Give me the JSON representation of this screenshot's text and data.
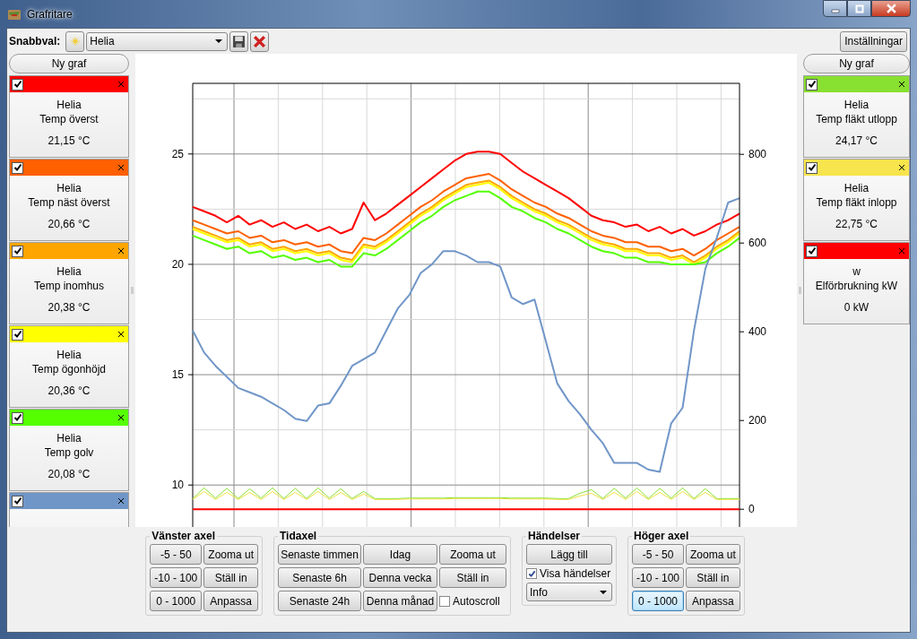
{
  "window": {
    "title": "Grafritare"
  },
  "toolbar": {
    "label": "Snabbval:",
    "preset": "Helia",
    "settings_button": "Inställningar"
  },
  "left_panel": {
    "new_button": "Ny graf",
    "series": [
      {
        "color": "#ff0000",
        "checked": true,
        "source": "Helia",
        "name": "Temp överst",
        "value": "21,15 °C"
      },
      {
        "color": "#ff6000",
        "checked": true,
        "source": "Helia",
        "name": "Temp näst överst",
        "value": "20,66 °C"
      },
      {
        "color": "#ffa500",
        "checked": true,
        "source": "Helia",
        "name": "Temp inomhus",
        "value": "20,38 °C"
      },
      {
        "color": "#ffff00",
        "checked": true,
        "source": "Helia",
        "name": "Temp ögonhöjd",
        "value": "20,36 °C"
      },
      {
        "color": "#55ff00",
        "checked": true,
        "source": "Helia",
        "name": "Temp golv",
        "value": "20,08 °C"
      },
      {
        "color": "#7096c8",
        "checked": true
      }
    ]
  },
  "right_panel": {
    "new_button": "Ny graf",
    "series": [
      {
        "color": "#88e030",
        "checked": true,
        "source": "Helia",
        "name": "Temp fläkt utlopp",
        "value": "24,17 °C"
      },
      {
        "color": "#f8e44c",
        "checked": true,
        "source": "Helia",
        "name": "Temp fläkt inlopp",
        "value": "22,75 °C"
      },
      {
        "color": "#ff0000",
        "checked": true,
        "source": "w",
        "name": "Elförbrukning kW",
        "value": "0 kW"
      }
    ]
  },
  "plot_left": {
    "chart_data": {
      "type": "line",
      "categories": [
        null,
        null,
        null,
        null,
        null,
        null,
        null,
        null,
        null,
        null,
        null,
        null,
        null,
        null,
        null,
        null,
        null,
        null,
        null,
        null,
        null,
        null,
        null,
        null,
        null,
        null,
        null,
        null,
        null,
        null,
        null,
        null,
        null,
        null,
        null,
        null,
        null,
        null,
        null,
        null,
        null,
        null,
        null,
        null,
        null,
        null,
        null,
        null,
        null
      ],
      "ylim": [
        8.1,
        28.2
      ],
      "yticks": [
        10,
        15,
        20,
        25
      ],
      "grid": true,
      "series": [
        {
          "color": "#ff0000",
          "values": [
            22.6,
            22.4,
            22.2,
            21.9,
            22.2,
            21.8,
            22.0,
            21.7,
            21.9,
            21.6,
            21.8,
            21.5,
            21.7,
            21.4,
            21.6,
            22.8,
            22.0,
            22.3,
            22.7,
            23.1,
            23.5,
            23.9,
            24.3,
            24.7,
            25.0,
            25.1,
            25.1,
            25.0,
            24.6,
            24.2,
            23.9,
            23.6,
            23.3,
            23.0,
            22.6,
            22.2,
            22.0,
            21.9,
            21.7,
            21.8,
            21.5,
            21.7,
            21.4,
            21.6,
            21.3,
            21.5,
            21.8,
            22.0,
            22.3
          ]
        },
        {
          "color": "#ff6000",
          "values": [
            22.0,
            21.8,
            21.6,
            21.4,
            21.5,
            21.2,
            21.3,
            21.0,
            21.1,
            20.9,
            21.0,
            20.8,
            20.9,
            20.6,
            20.5,
            21.2,
            21.1,
            21.4,
            21.8,
            22.2,
            22.6,
            22.9,
            23.3,
            23.6,
            23.9,
            24.0,
            24.1,
            23.8,
            23.4,
            23.1,
            22.8,
            22.6,
            22.3,
            22.1,
            21.8,
            21.5,
            21.3,
            21.2,
            21.0,
            21.0,
            20.8,
            20.8,
            20.6,
            20.7,
            20.4,
            20.7,
            21.1,
            21.4,
            21.7
          ]
        },
        {
          "color": "#ffa500",
          "values": [
            21.7,
            21.5,
            21.3,
            21.1,
            21.2,
            20.9,
            21.0,
            20.7,
            20.8,
            20.6,
            20.7,
            20.5,
            20.6,
            20.3,
            20.2,
            20.9,
            20.8,
            21.1,
            21.5,
            21.9,
            22.3,
            22.6,
            23.0,
            23.3,
            23.6,
            23.7,
            23.8,
            23.5,
            23.1,
            22.8,
            22.5,
            22.3,
            22.0,
            21.8,
            21.5,
            21.2,
            21.0,
            20.9,
            20.7,
            20.7,
            20.5,
            20.5,
            20.3,
            20.4,
            20.1,
            20.4,
            20.8,
            21.1,
            21.5
          ]
        },
        {
          "color": "#ffff00",
          "values": [
            21.6,
            21.4,
            21.2,
            21.0,
            21.1,
            20.8,
            20.9,
            20.6,
            20.7,
            20.5,
            20.6,
            20.4,
            20.5,
            20.2,
            20.1,
            20.8,
            20.7,
            21.0,
            21.4,
            21.8,
            22.2,
            22.5,
            22.9,
            23.2,
            23.5,
            23.6,
            23.7,
            23.4,
            23.0,
            22.7,
            22.4,
            22.2,
            21.9,
            21.7,
            21.4,
            21.1,
            20.9,
            20.8,
            20.6,
            20.6,
            20.4,
            20.4,
            20.2,
            20.3,
            20.0,
            20.3,
            20.7,
            21.0,
            21.4
          ]
        },
        {
          "color": "#55ff00",
          "values": [
            21.3,
            21.1,
            20.9,
            20.7,
            20.8,
            20.5,
            20.6,
            20.3,
            20.4,
            20.2,
            20.3,
            20.1,
            20.2,
            19.9,
            19.9,
            20.5,
            20.4,
            20.7,
            21.1,
            21.5,
            21.9,
            22.2,
            22.6,
            22.9,
            23.1,
            23.3,
            23.3,
            23.0,
            22.6,
            22.4,
            22.1,
            21.9,
            21.6,
            21.4,
            21.1,
            20.8,
            20.6,
            20.5,
            20.3,
            20.3,
            20.1,
            20.1,
            20.0,
            20.0,
            20.0,
            20.1,
            20.5,
            20.8,
            21.2
          ]
        },
        {
          "color": "#7096c8",
          "values": [
            17.0,
            16.0,
            15.4,
            14.9,
            14.4,
            14.2,
            14.0,
            13.7,
            13.4,
            13.0,
            12.9,
            13.6,
            13.7,
            14.5,
            15.4,
            15.7,
            16.0,
            17.0,
            18.0,
            18.6,
            19.6,
            20.0,
            20.6,
            20.6,
            20.4,
            20.1,
            20.1,
            19.9,
            18.5,
            18.2,
            18.4,
            16.5,
            14.6,
            13.8,
            13.2,
            12.5,
            11.9,
            11.0,
            11.0,
            11.0,
            10.7,
            10.6,
            12.8,
            13.5,
            17.0,
            19.8,
            21.2,
            22.8,
            23.0
          ]
        }
      ]
    }
  },
  "plot_right": {
    "chart_data": {
      "type": "line",
      "categories": [
        null,
        null,
        null,
        null,
        null,
        null,
        null,
        null,
        null,
        null,
        null,
        null,
        null,
        null,
        null,
        null,
        null,
        null,
        null,
        null,
        null,
        null,
        null,
        null,
        null,
        null,
        null,
        null,
        null,
        null,
        null,
        null,
        null,
        null,
        null,
        null,
        null,
        null,
        null,
        null,
        null,
        null,
        null,
        null,
        null,
        null,
        null,
        null,
        null
      ],
      "ylim": [
        -40,
        960
      ],
      "yticks": [
        0,
        200,
        400,
        600,
        800
      ],
      "series": [
        {
          "color": "#88e030",
          "values": [
            24,
            48,
            25,
            47,
            24,
            46,
            25,
            48,
            24,
            47,
            24,
            48,
            25,
            46,
            24,
            40,
            24,
            24,
            24,
            25,
            25,
            25,
            25,
            26,
            26,
            26,
            26,
            26,
            25,
            25,
            25,
            25,
            24,
            24,
            36,
            44,
            24,
            47,
            25,
            48,
            24,
            47,
            25,
            48,
            24,
            46,
            24,
            24,
            24
          ]
        },
        {
          "color": "#f0e040",
          "values": [
            22,
            40,
            22,
            38,
            22,
            38,
            22,
            40,
            22,
            38,
            22,
            40,
            22,
            38,
            22,
            34,
            22,
            22,
            22,
            23,
            23,
            23,
            23,
            24,
            24,
            24,
            24,
            24,
            23,
            23,
            23,
            23,
            22,
            22,
            30,
            36,
            22,
            38,
            22,
            40,
            22,
            38,
            22,
            40,
            22,
            38,
            22,
            22,
            22
          ]
        },
        {
          "color": "#ff0000",
          "values": [
            0,
            0,
            0,
            0,
            0,
            0,
            0,
            0,
            0,
            0,
            0,
            0,
            0,
            0,
            0,
            0,
            0,
            0,
            0,
            0,
            0,
            0,
            0,
            0,
            0,
            0,
            0,
            0,
            0,
            0,
            0,
            0,
            0,
            0,
            0,
            0,
            0,
            0,
            0,
            0,
            0,
            0,
            0,
            0,
            0,
            0,
            0,
            0,
            0
          ]
        }
      ]
    }
  },
  "left_axis": {
    "title": "Vänster axel",
    "buttons": [
      {
        "label": "-5 - 50",
        "selected": false
      },
      {
        "label": "Zooma ut",
        "selected": false
      },
      {
        "label": "-10 - 100",
        "selected": false
      },
      {
        "label": "Ställ in",
        "selected": false
      },
      {
        "label": "0 - 1000",
        "selected": false
      },
      {
        "label": "Anpassa",
        "selected": false
      }
    ]
  },
  "time_axis": {
    "title": "Tidaxel",
    "buttons": [
      "Senaste timmen",
      "Idag",
      "Zooma ut",
      "Senaste 6h",
      "Denna vecka",
      "Ställ in",
      "Senaste 24h",
      "Denna månad"
    ],
    "autoscroll": {
      "label": "Autoscroll",
      "checked": false
    }
  },
  "events": {
    "title": "Händelser",
    "add_button": "Lägg till",
    "show_events": {
      "label": "Visa händelser",
      "checked": true
    },
    "filter": "Info"
  },
  "right_axis": {
    "title": "Höger axel",
    "buttons": [
      {
        "label": "-5 - 50",
        "selected": false
      },
      {
        "label": "Zooma ut",
        "selected": false
      },
      {
        "label": "-10 - 100",
        "selected": false
      },
      {
        "label": "Ställ in",
        "selected": false
      },
      {
        "label": "0 - 1000",
        "selected": true
      },
      {
        "label": "Anpassa",
        "selected": false
      }
    ]
  }
}
